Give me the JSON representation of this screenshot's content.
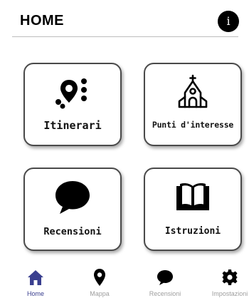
{
  "header": {
    "title": "HOME",
    "info_icon_glyph": "i"
  },
  "cards": [
    {
      "label": "Itinerari",
      "icon": "route-pin-icon"
    },
    {
      "label": "Punti d'interesse",
      "icon": "church-icon"
    },
    {
      "label": "Recensioni",
      "icon": "speech-bubble-icon"
    },
    {
      "label": "Istruzioni",
      "icon": "open-book-icon"
    }
  ],
  "navbar": {
    "items": [
      {
        "label": "Home",
        "icon": "home-icon",
        "active": true
      },
      {
        "label": "Mappa",
        "icon": "map-pin-icon",
        "active": false
      },
      {
        "label": "Recensioni",
        "icon": "chat-bubble-icon",
        "active": false
      },
      {
        "label": "Impostazioni",
        "icon": "gear-icon",
        "active": false
      }
    ]
  },
  "colors": {
    "accent": "#3a3f8f",
    "inactive_nav": "#9e9e9e",
    "icon": "#000000"
  }
}
